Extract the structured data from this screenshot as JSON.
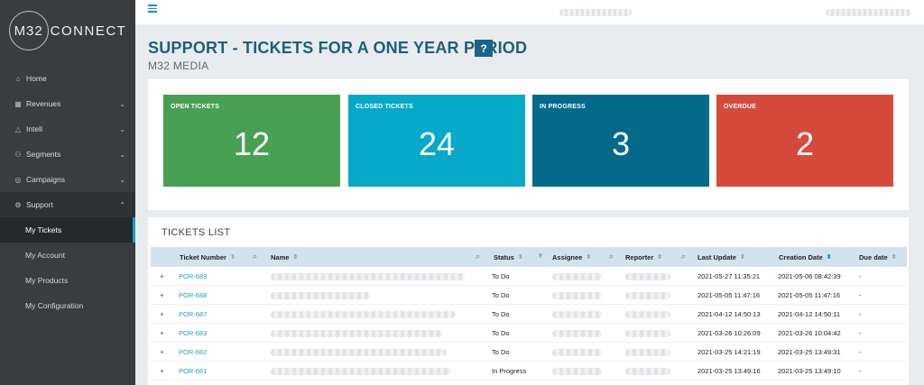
{
  "logo": {
    "mark": "M32",
    "word": "CONNECT"
  },
  "sidebar": {
    "items": [
      {
        "label": "Home",
        "icon": "home-icon",
        "glyph": "⌂",
        "chevron": ""
      },
      {
        "label": "Revenues",
        "icon": "bar-chart-icon",
        "glyph": "▦",
        "chevron": "⌄"
      },
      {
        "label": "Intell",
        "icon": "triangle-icon",
        "glyph": "△",
        "chevron": "⌄"
      },
      {
        "label": "Segments",
        "icon": "users-icon",
        "glyph": "⚇",
        "chevron": "⌄"
      },
      {
        "label": "Campaigns",
        "icon": "campaign-icon",
        "glyph": "◎",
        "chevron": "⌄"
      },
      {
        "label": "Support",
        "icon": "gear-icon",
        "glyph": "⚙",
        "chevron": "⌃"
      }
    ],
    "subitems": [
      {
        "label": "My Tickets",
        "active": true
      },
      {
        "label": "My Account",
        "active": false
      },
      {
        "label": "My Products",
        "active": false
      },
      {
        "label": "My Configuration",
        "active": false
      }
    ]
  },
  "page": {
    "title": "SUPPORT - TICKETS FOR A ONE YEAR PERIOD",
    "help": "?",
    "subtitle": "M32 MEDIA"
  },
  "tiles": [
    {
      "label": "OPEN TICKETS",
      "value": "12",
      "color": "#48a152"
    },
    {
      "label": "CLOSED TICKETS",
      "value": "24",
      "color": "#07a9c9"
    },
    {
      "label": "IN PROGRESS",
      "value": "3",
      "color": "#036a8a"
    },
    {
      "label": "OVERDUE",
      "value": "2",
      "color": "#d64a3c"
    }
  ],
  "tickets": {
    "title": "TICKETS LIST",
    "columns": [
      "Ticket Number",
      "Name",
      "Status",
      "Assignee",
      "Reporter",
      "Last Update",
      "Creation Date",
      "Due date"
    ],
    "rows": [
      {
        "number": "POR-689",
        "status": "To Do",
        "last_update": "2021-05-27 11:35:21",
        "created": "2021-05-06 08:42:39",
        "due": "-"
      },
      {
        "number": "POR-688",
        "status": "To Do",
        "last_update": "2021-05-05 11:47:16",
        "created": "2021-05-05 11:47:16",
        "due": "-"
      },
      {
        "number": "POR-687",
        "status": "To Do",
        "last_update": "2021-04-12 14:50:13",
        "created": "2021-04-12 14:50:11",
        "due": "-"
      },
      {
        "number": "POR-683",
        "status": "To Do",
        "last_update": "2021-03-26 10:26:09",
        "created": "2021-03-26 10:04:42",
        "due": "-"
      },
      {
        "number": "POR-682",
        "status": "To Do",
        "last_update": "2021-03-25 14:21:19",
        "created": "2021-03-25 13:49:31",
        "due": "-"
      },
      {
        "number": "POR-681",
        "status": "In Progress",
        "last_update": "2021-03-25 13:49:16",
        "created": "2021-03-25 13:49:10",
        "due": "-"
      }
    ]
  }
}
